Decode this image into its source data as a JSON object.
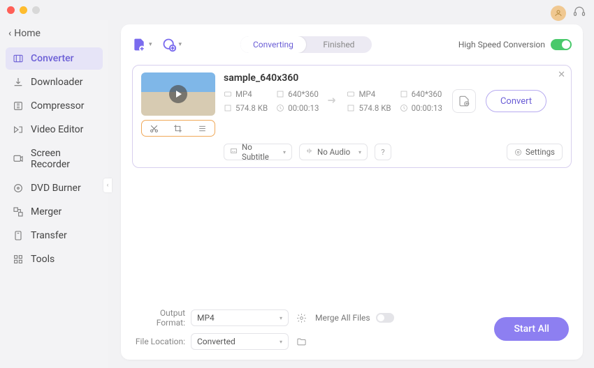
{
  "home_label": "Home",
  "sidebar": {
    "items": [
      {
        "label": "Converter"
      },
      {
        "label": "Downloader"
      },
      {
        "label": "Compressor"
      },
      {
        "label": "Video Editor"
      },
      {
        "label": "Screen Recorder"
      },
      {
        "label": "DVD Burner"
      },
      {
        "label": "Merger"
      },
      {
        "label": "Transfer"
      },
      {
        "label": "Tools"
      }
    ]
  },
  "tabs": {
    "converting": "Converting",
    "finished": "Finished"
  },
  "speed_label": "High Speed Conversion",
  "file": {
    "name": "sample_640x360",
    "src": {
      "format": "MP4",
      "dim": "640*360",
      "size": "574.8 KB",
      "dur": "00:00:13"
    },
    "dst": {
      "format": "MP4",
      "dim": "640*360",
      "size": "574.8 KB",
      "dur": "00:00:13"
    },
    "subtitle": "No Subtitle",
    "audio": "No Audio",
    "help": "?",
    "settings": "Settings",
    "convert": "Convert"
  },
  "footer": {
    "format_label": "Output Format:",
    "format_value": "MP4",
    "location_label": "File Location:",
    "location_value": "Converted",
    "merge_label": "Merge All Files",
    "start_all": "Start All"
  }
}
